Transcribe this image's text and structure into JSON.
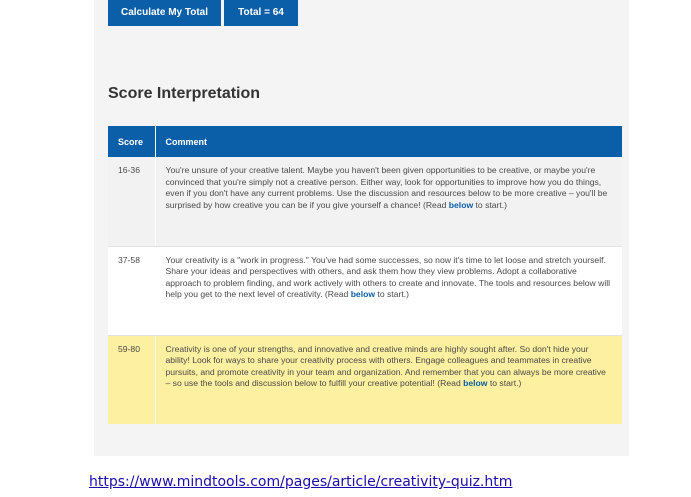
{
  "buttons": {
    "calculate_label": "Calculate My Total",
    "total_label": "Total = 64"
  },
  "section": {
    "title": "Score Interpretation"
  },
  "table": {
    "headers": [
      "Score",
      "Comment"
    ],
    "rows": [
      {
        "score": "16-36",
        "comment_before": "You're unsure of your creative talent. Maybe you haven't been given opportunities to be creative, or maybe you're convinced that you're simply not a creative person. Either way, look for opportunities to improve how you do things, even if you don't have any current problems. Use the discussion and resources below to be more creative – you'll be surprised by how creative you can be if you give yourself a chance! (Read ",
        "link": "below",
        "comment_after": " to start.)"
      },
      {
        "score": "37-58",
        "comment_before": "Your creativity is a \"work in progress.\" You've had some successes, so now it's time to let loose and stretch yourself. Share your ideas and perspectives with others, and ask them how they view problems. Adopt a collaborative approach to problem finding, and work actively with others to create and innovate. The tools and resources below will help you get to the next level of creativity. (Read ",
        "link": "below",
        "comment_after": " to start.)"
      },
      {
        "score": "59-80",
        "comment_before": "Creativity is one of your strengths, and innovative and creative minds are highly sought after. So don't hide your ability! Look for ways to share your creativity process with others. Engage colleagues and teammates in creative pursuits, and promote creativity in your team and organization. And remember that you can always be more creative – so use the tools and discussion below to fulfill your creative potential! (Read ",
        "link": "below",
        "comment_after": " to start.)"
      }
    ]
  },
  "source": {
    "url": "https://www.mindtools.com/pages/article/creativity-quiz.htm"
  },
  "colors": {
    "brand_blue": "#0b5ea8",
    "highlight_yellow": "#fdf0a0",
    "link_blue": "#1a0dab"
  }
}
